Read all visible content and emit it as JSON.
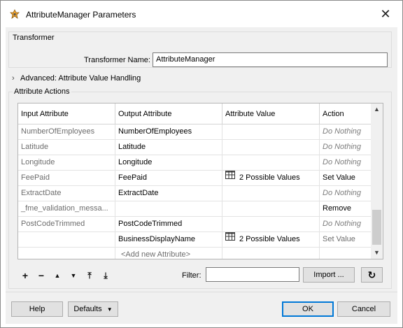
{
  "window": {
    "title": "AttributeManager Parameters",
    "close_glyph": "✕"
  },
  "transformer_group": {
    "label": "Transformer",
    "name_label": "Transformer Name:",
    "name_value": "AttributeManager"
  },
  "advanced": {
    "label": "Advanced: Attribute Value Handling",
    "chevron": "›"
  },
  "actions_group": {
    "label": "Attribute Actions"
  },
  "table": {
    "headers": [
      "Input Attribute",
      "Output Attribute",
      "Attribute Value",
      "Action"
    ],
    "rows": [
      {
        "input": "NumberOfEmployees",
        "output": "NumberOfEmployees",
        "value": "",
        "action": "Do Nothing"
      },
      {
        "input": "Latitude",
        "output": "Latitude",
        "value": "",
        "action": "Do Nothing"
      },
      {
        "input": "Longitude",
        "output": "Longitude",
        "value": "",
        "action": "Do Nothing"
      },
      {
        "input": "FeePaid",
        "output": "FeePaid",
        "value": "2 Possible Values",
        "action": "Set Value"
      },
      {
        "input": "ExtractDate",
        "output": "ExtractDate",
        "value": "",
        "action": "Do Nothing"
      },
      {
        "input": "_fme_validation_messa...",
        "output": "",
        "value": "",
        "action": "Remove"
      },
      {
        "input": "PostCodeTrimmed",
        "output": "PostCodeTrimmed",
        "value": "",
        "action": "Do Nothing"
      },
      {
        "input": "",
        "output": "BusinessDisplayName",
        "value": "2 Possible Values",
        "action": "Set Value"
      }
    ],
    "add_new": "<Add new Attribute>",
    "scroll_up": "▲",
    "scroll_down": "▼"
  },
  "toolbar": {
    "add": "+",
    "remove": "−",
    "up": "▲",
    "down": "▼",
    "top": "⤒",
    "bottom": "⤓"
  },
  "filter": {
    "label": "Filter:",
    "value": ""
  },
  "import_label": "Import ...",
  "refresh_glyph": "↻",
  "footer": {
    "help": "Help",
    "defaults": "Defaults",
    "defaults_arrow": "▼",
    "ok": "OK",
    "cancel": "Cancel"
  },
  "colors": {
    "accent": "#0078d7",
    "dialog_bg": "#f0f0f0"
  }
}
